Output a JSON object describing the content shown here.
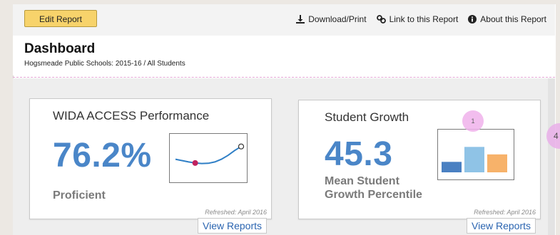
{
  "toolbar": {
    "edit_label": "Edit Report",
    "links": [
      {
        "label": "Download/Print",
        "icon": "download-icon"
      },
      {
        "label": "Link to this Report",
        "icon": "link-icon"
      },
      {
        "label": "About this Report",
        "icon": "info-icon"
      }
    ]
  },
  "header": {
    "title": "Dashboard",
    "subtitle": "Hogsmeade Public Schools: 2015-16 / All Students"
  },
  "cards": [
    {
      "title": "WIDA ACCESS Performance",
      "value": "76.2%",
      "label": "Proficient",
      "refreshed": "Refreshed: April 2016",
      "link": "View Reports",
      "trend": [
        0.38,
        0.33,
        0.28,
        0.24,
        0.22,
        0.23,
        0.28,
        0.38,
        0.52,
        0.7,
        0.85
      ],
      "highlight_point": 3,
      "colors": {
        "line": "#2f7fc6",
        "marker": "#c0235f"
      }
    },
    {
      "title": "Student Growth",
      "value": "45.3",
      "label_line1": "Mean Student",
      "label_line2": "Growth Percentile",
      "refreshed": "Refreshed: April 2016",
      "link": "View Reports",
      "bars": [
        0.35,
        0.85,
        0.6
      ],
      "colors": {
        "bars": [
          "#4a80c2",
          "#8fc3e6",
          "#f7b26a"
        ]
      }
    }
  ],
  "annotations": {
    "badge_1": "1",
    "badge_4": "4"
  },
  "colors": {
    "accent_blue": "#4a86c8",
    "edit_button": "#f7d36b",
    "link_blue": "#2a64b0"
  }
}
